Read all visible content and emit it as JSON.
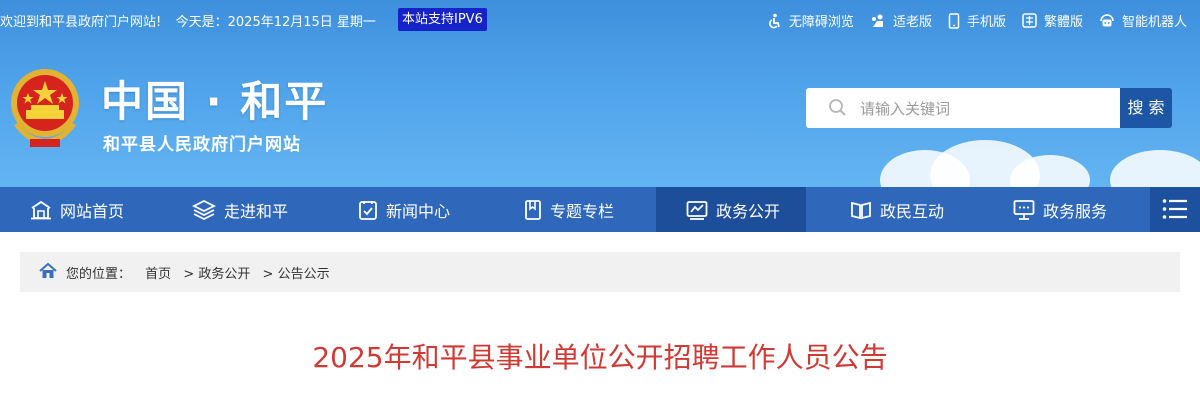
{
  "topbar": {
    "welcome": "欢迎到和平县政府门户网站!",
    "today": "今天是：2025年12月15日 星期一",
    "ipv6": "本站支持IPV6",
    "links": [
      {
        "label": "无障碍浏览",
        "icon": "accessibility-icon"
      },
      {
        "label": "适老版",
        "icon": "elderly-icon"
      },
      {
        "label": "手机版",
        "icon": "mobile-icon"
      },
      {
        "label": "繁體版",
        "icon": "traditional-chinese-icon"
      },
      {
        "label": "智能机器人",
        "icon": "robot-icon"
      }
    ]
  },
  "header": {
    "title": "中国 · 和平",
    "subtitle": "和平县人民政府门户网站",
    "emblem_icon": "national-emblem-icon"
  },
  "search": {
    "placeholder": "请输入关键词",
    "button_label": "搜 索",
    "icon": "search-icon"
  },
  "nav": {
    "items": [
      {
        "label": "网站首页",
        "icon": "home-icon"
      },
      {
        "label": "走进和平",
        "icon": "layers-icon"
      },
      {
        "label": "新闻中心",
        "icon": "news-icon"
      },
      {
        "label": "专题专栏",
        "icon": "bookmark-icon"
      },
      {
        "label": "政务公开",
        "icon": "chart-icon",
        "active": true
      },
      {
        "label": "政民互动",
        "icon": "book-open-icon"
      },
      {
        "label": "政务服务",
        "icon": "monitor-icon"
      }
    ],
    "menu_icon": "menu-icon"
  },
  "breadcrumb": {
    "prefix": "您的位置：",
    "items": [
      "首页",
      "政务公开",
      "公告公示"
    ],
    "separator": ">",
    "icon": "home-icon"
  },
  "article": {
    "title": "2025年和平县事业单位公开招聘工作人员公告"
  },
  "colors": {
    "header_top": "#3e8fdc",
    "nav_bg": "#2f68bb",
    "nav_active": "#1d4e9a",
    "search_button": "#1e56a6",
    "ipv6_badge": "#1623c8",
    "title_red": "#d13a34"
  }
}
